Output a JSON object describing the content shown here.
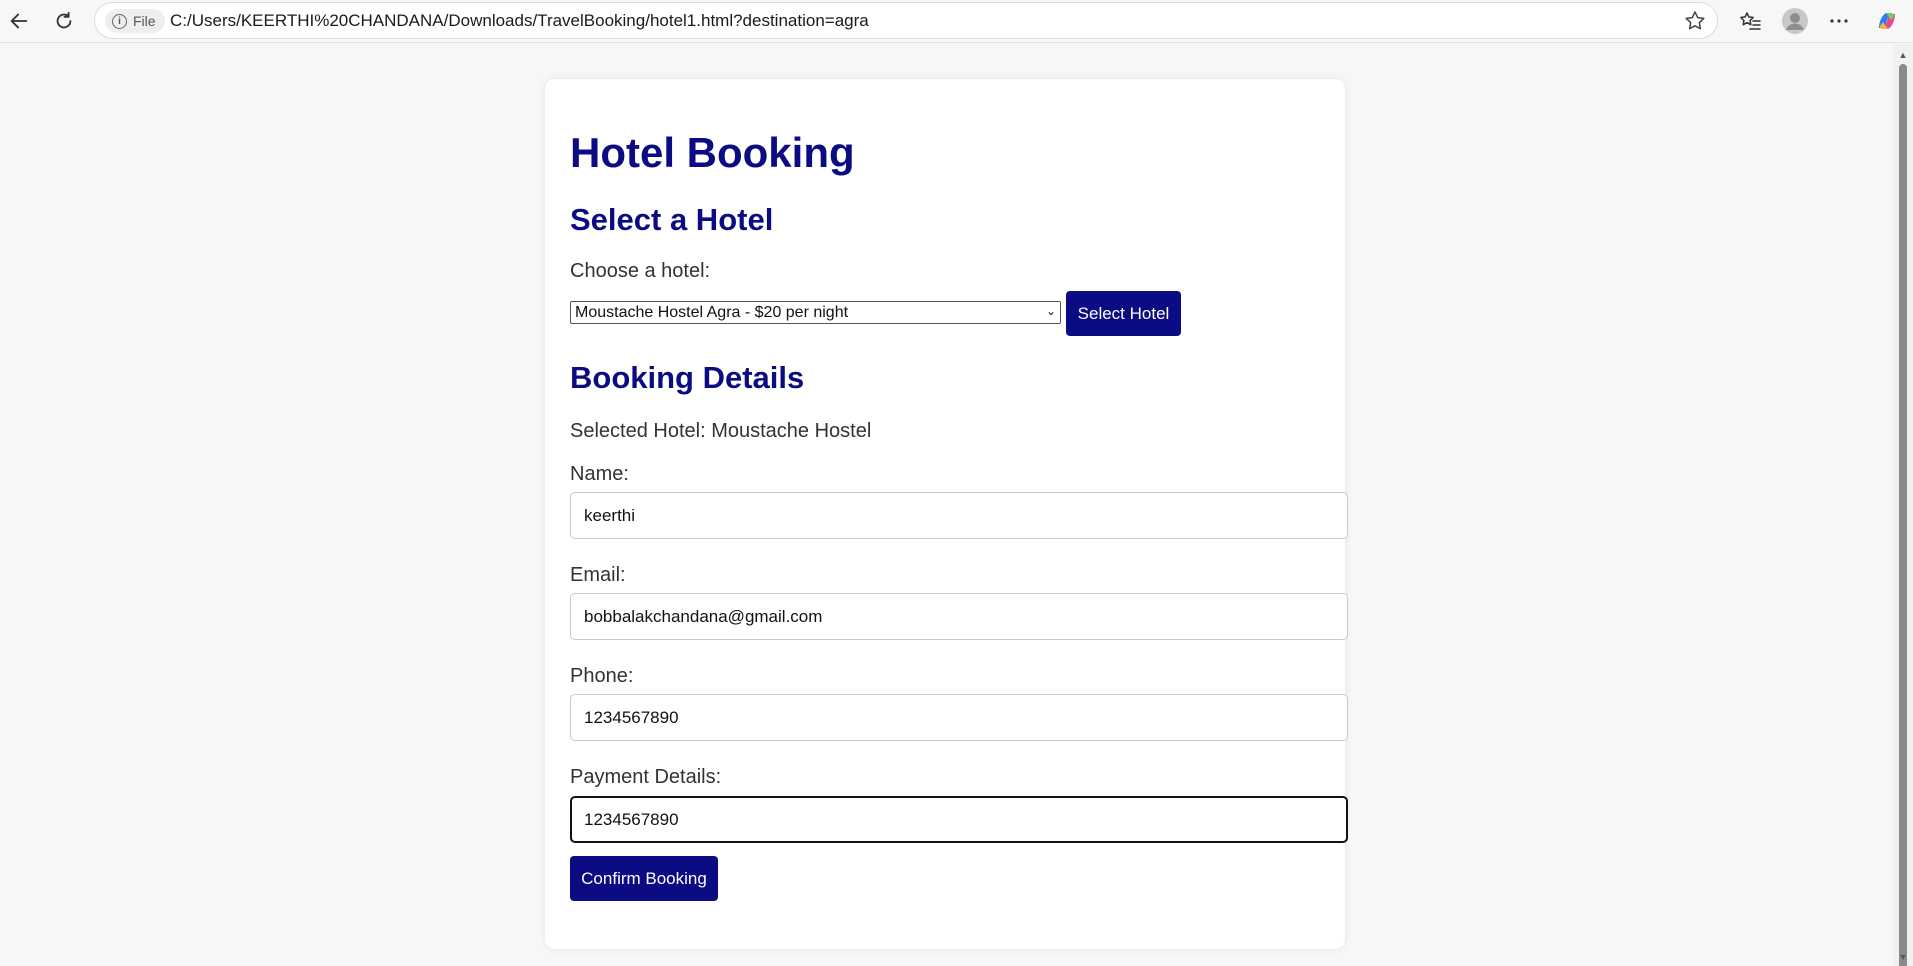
{
  "browser": {
    "file_chip_label": "File",
    "url": "C:/Users/KEERTHI%20CHANDANA/Downloads/TravelBooking/hotel1.html?destination=agra"
  },
  "page": {
    "title": "Hotel Booking",
    "select_section": {
      "heading": "Select a Hotel",
      "choose_label": "Choose a hotel:",
      "selected_option": "Moustache Hostel Agra - $20 per night",
      "button_label": "Select Hotel"
    },
    "booking": {
      "heading": "Booking Details",
      "selected_hotel_text": "Selected Hotel: Moustache Hostel",
      "name_label": "Name:",
      "name_value": "keerthi",
      "email_label": "Email:",
      "email_value": "bobbalakchandana@gmail.com",
      "phone_label": "Phone:",
      "phone_value": "1234567890",
      "payment_label": "Payment Details:",
      "payment_value": "1234567890",
      "confirm_label": "Confirm Booking"
    }
  },
  "icons": {
    "back": "back-arrow-icon",
    "refresh": "refresh-icon",
    "info": "info-icon",
    "favorite": "star-icon",
    "favorites_list": "favorites-icon",
    "profile": "profile-icon",
    "menu": "more-icon",
    "copilot": "copilot-icon"
  },
  "colors": {
    "accent": "#0b0b84",
    "page_bg": "#f6f7f8",
    "card_bg": "#ffffff"
  }
}
